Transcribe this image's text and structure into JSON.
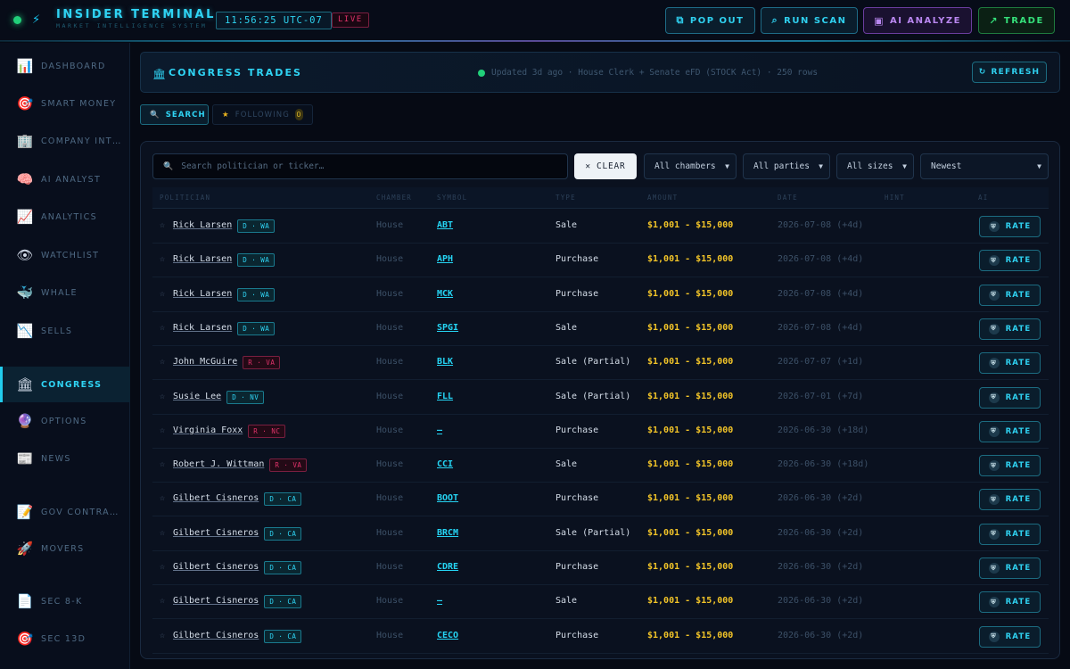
{
  "app": {
    "title": "INSIDER TERMINAL",
    "subtitle": "MARKET INTELLIGENCE SYSTEM",
    "clock": "11:56:25 UTC-07",
    "live": "LIVE"
  },
  "toolbar": {
    "pop_out": "POP OUT",
    "run_scan": "RUN SCAN",
    "ai_analyze": "AI ANALYZE",
    "trade": "TRADE"
  },
  "sidebar": {
    "items": [
      {
        "label": "DASHBOARD",
        "icon": "bar-chart-icon"
      },
      {
        "label": "SMART MONEY",
        "icon": "target-icon"
      },
      {
        "label": "COMPANY INT…",
        "icon": "building-icon"
      },
      {
        "label": "AI ANALYST",
        "icon": "brain-icon"
      },
      {
        "label": "ANALYTICS",
        "icon": "trend-chart-icon"
      },
      {
        "label": "WATCHLIST",
        "icon": "eye-icon"
      },
      {
        "label": "WHALE",
        "icon": "whale-icon"
      },
      {
        "label": "SELLS",
        "icon": "trend-down-icon"
      },
      {
        "label": "CONGRESS",
        "icon": "capitol-icon"
      },
      {
        "label": "OPTIONS",
        "icon": "crystal-ball-icon"
      },
      {
        "label": "NEWS",
        "icon": "newspaper-icon"
      },
      {
        "label": "GOV CONTRA…",
        "icon": "document-icon"
      },
      {
        "label": "MOVERS",
        "icon": "rocket-icon"
      },
      {
        "label": "SEC 8-K",
        "icon": "page-icon"
      },
      {
        "label": "SEC 13D",
        "icon": "target-icon"
      }
    ],
    "active": "CONGRESS"
  },
  "header": {
    "title": "CONGRESS TRADES",
    "status": "Updated 3d ago · House Clerk + Senate eFD (STOCK Act) · 250 rows",
    "refresh": "REFRESH"
  },
  "tabs": {
    "search": "SEARCH",
    "following": "FOLLOWING",
    "following_count": "0"
  },
  "filters": {
    "search_placeholder": "Search politician or ticker…",
    "clear": "CLEAR",
    "chambers": "All chambers",
    "parties": "All parties",
    "sizes": "All sizes",
    "sort": "Newest"
  },
  "table": {
    "headers": [
      "POLITICIAN",
      "CHAMBER",
      "SYMBOL",
      "TYPE",
      "AMOUNT",
      "DATE",
      "HINT",
      "AI"
    ],
    "rate_label": "RATE",
    "rows": [
      {
        "politician": "Rick Larsen",
        "party": "D · WA",
        "chamber": "House",
        "symbol": "ABT",
        "type": "Sale",
        "amount": "$1,001 - $15,000",
        "date": "2026-07-08 (+4d)"
      },
      {
        "politician": "Rick Larsen",
        "party": "D · WA",
        "chamber": "House",
        "symbol": "APH",
        "type": "Purchase",
        "amount": "$1,001 - $15,000",
        "date": "2026-07-08 (+4d)"
      },
      {
        "politician": "Rick Larsen",
        "party": "D · WA",
        "chamber": "House",
        "symbol": "MCK",
        "type": "Purchase",
        "amount": "$1,001 - $15,000",
        "date": "2026-07-08 (+4d)"
      },
      {
        "politician": "Rick Larsen",
        "party": "D · WA",
        "chamber": "House",
        "symbol": "SPGI",
        "type": "Sale",
        "amount": "$1,001 - $15,000",
        "date": "2026-07-08 (+4d)"
      },
      {
        "politician": "John McGuire",
        "party": "R · VA",
        "chamber": "House",
        "symbol": "BLK",
        "type": "Sale (Partial)",
        "amount": "$1,001 - $15,000",
        "date": "2026-07-07 (+1d)"
      },
      {
        "politician": "Susie Lee",
        "party": "D · NV",
        "chamber": "House",
        "symbol": "FLL",
        "type": "Sale (Partial)",
        "amount": "$1,001 - $15,000",
        "date": "2026-07-01 (+7d)"
      },
      {
        "politician": "Virginia Foxx",
        "party": "R · NC",
        "chamber": "House",
        "symbol": "—",
        "type": "Purchase",
        "amount": "$1,001 - $15,000",
        "date": "2026-06-30 (+18d)"
      },
      {
        "politician": "Robert J. Wittman",
        "party": "R · VA",
        "chamber": "House",
        "symbol": "CCI",
        "type": "Sale",
        "amount": "$1,001 - $15,000",
        "date": "2026-06-30 (+18d)"
      },
      {
        "politician": "Gilbert Cisneros",
        "party": "D · CA",
        "chamber": "House",
        "symbol": "BOOT",
        "type": "Purchase",
        "amount": "$1,001 - $15,000",
        "date": "2026-06-30 (+2d)"
      },
      {
        "politician": "Gilbert Cisneros",
        "party": "D · CA",
        "chamber": "House",
        "symbol": "BRCM",
        "type": "Sale (Partial)",
        "amount": "$1,001 - $15,000",
        "date": "2026-06-30 (+2d)"
      },
      {
        "politician": "Gilbert Cisneros",
        "party": "D · CA",
        "chamber": "House",
        "symbol": "CDRE",
        "type": "Purchase",
        "amount": "$1,001 - $15,000",
        "date": "2026-06-30 (+2d)"
      },
      {
        "politician": "Gilbert Cisneros",
        "party": "D · CA",
        "chamber": "House",
        "symbol": "—",
        "type": "Sale",
        "amount": "$1,001 - $15,000",
        "date": "2026-06-30 (+2d)"
      },
      {
        "politician": "Gilbert Cisneros",
        "party": "D · CA",
        "chamber": "House",
        "symbol": "CECO",
        "type": "Purchase",
        "amount": "$1,001 - $15,000",
        "date": "2026-06-30 (+2d)"
      }
    ]
  }
}
